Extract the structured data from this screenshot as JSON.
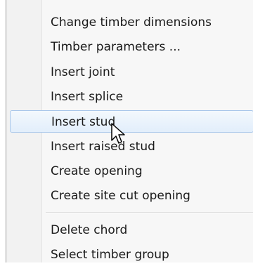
{
  "context_menu": {
    "items": [
      {
        "label": "Change timber dimensions"
      },
      {
        "label": "Timber parameters ..."
      },
      {
        "label": "Insert joint"
      },
      {
        "label": "Insert splice"
      },
      {
        "label": "Insert stud",
        "highlighted": true
      },
      {
        "label": "Insert raised stud"
      },
      {
        "label": "Create opening"
      },
      {
        "label": "Create site cut opening"
      },
      {
        "label": "Delete chord"
      },
      {
        "label": "Select timber group"
      }
    ]
  },
  "cursor": {
    "icon": "arrow-pointer-icon"
  },
  "colors": {
    "highlight_border": "#a9c7ea",
    "highlight_fill": "#e2eefb",
    "menu_background": "#f7f7f7",
    "text": "#1a1a1a"
  }
}
